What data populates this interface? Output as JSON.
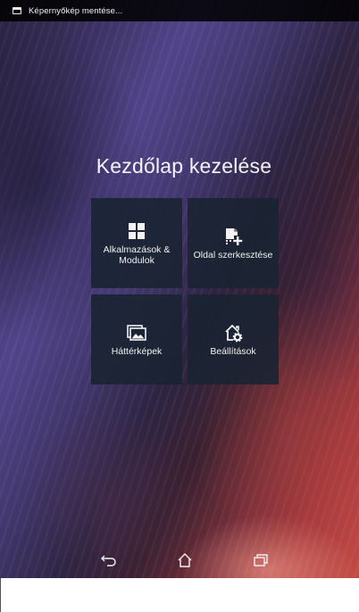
{
  "status_bar": {
    "notification_icon": "screenshot-icon",
    "notification_text": "Képernyőkép mentése..."
  },
  "home_manage": {
    "title": "Kezdőlap kezelése",
    "tiles": [
      {
        "label": "Alkalmazások & Modulok",
        "icon": "apps-grid-icon"
      },
      {
        "label": "Oldal szerkesztése",
        "icon": "page-edit-icon"
      },
      {
        "label": "Háttérképek",
        "icon": "wallpaper-icon"
      },
      {
        "label": "Beállítások",
        "icon": "home-settings-icon"
      }
    ]
  },
  "nav_bar": {
    "back_icon": "back-icon",
    "home_icon": "home-icon",
    "recent_icon": "recent-apps-icon"
  },
  "colors": {
    "tile_background": "#1a2432",
    "text": "#f2f2f2",
    "status_bar": "#000000"
  }
}
